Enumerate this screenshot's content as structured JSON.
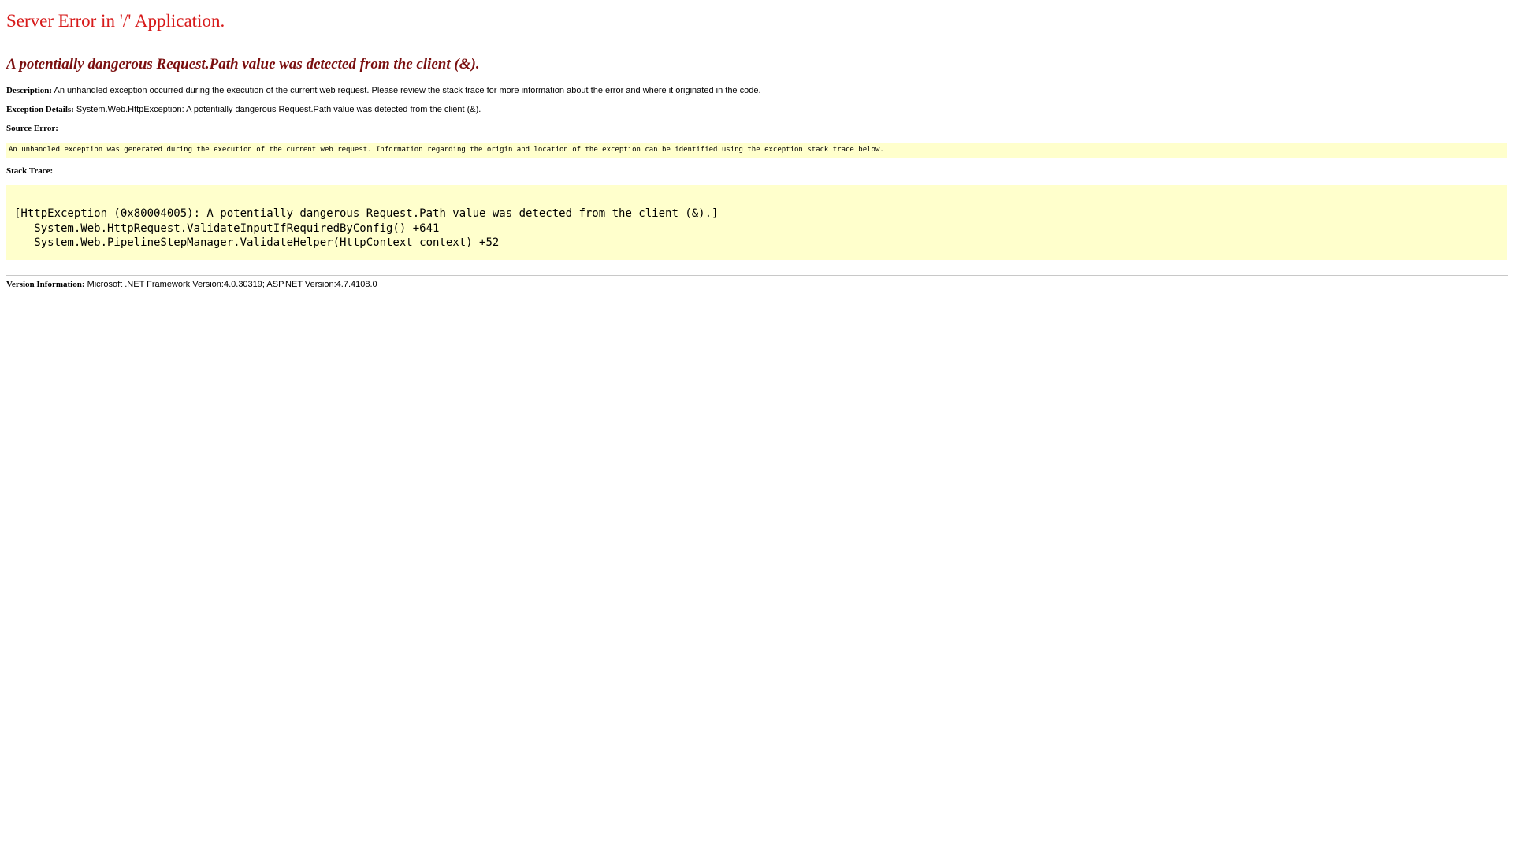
{
  "page": {
    "title": "Server Error in '/' Application.",
    "subtitle": "A potentially dangerous Request.Path value was detected from the client (&).",
    "description": {
      "label": "Description:",
      "text": " An unhandled exception occurred during the execution of the current web request. Please review the stack trace for more information about the error and where it originated in the code."
    },
    "exception_details": {
      "label": "Exception Details:",
      "text": " System.Web.HttpException: A potentially dangerous Request.Path value was detected from the client (&)."
    },
    "source_error": {
      "label": "Source Error:",
      "text": "An unhandled exception was generated during the execution of the current web request. Information regarding the origin and location of the exception can be identified using the exception stack trace below."
    },
    "stack_trace": {
      "label": "Stack Trace:",
      "lines": [
        "[HttpException (0x80004005): A potentially dangerous Request.Path value was detected from the client (&).]",
        "   System.Web.HttpRequest.ValidateInputIfRequiredByConfig() +641",
        "   System.Web.PipelineStepManager.ValidateHelper(HttpContext context) +52"
      ]
    },
    "version_info": {
      "label": "Version Information:",
      "text": " Microsoft .NET Framework Version:4.0.30319; ASP.NET Version:4.7.4108.0"
    }
  },
  "colors": {
    "title": "#d71a1a",
    "subtitle": "#7a0f0f",
    "code_background": "#ffffcc",
    "rule": "#c8c8c8"
  }
}
